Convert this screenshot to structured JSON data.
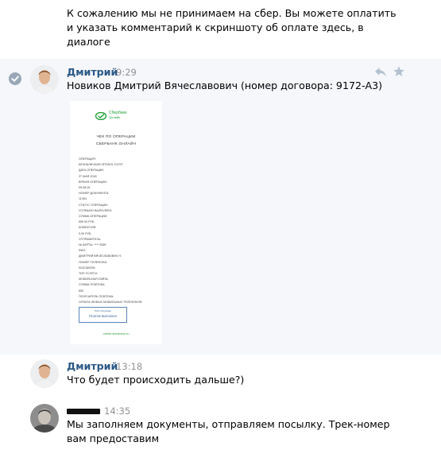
{
  "messages": [
    {
      "text_lines": [
        "К сожалению мы не принимаем на сбер. Вы можете оплатить",
        "и указать комментарий к скриншоту об оплате здесь, в",
        "диалоге"
      ]
    },
    {
      "author": "Дмитрий",
      "time": "9:29",
      "text": "Новиков Дмитрий Вячеславович (номер договора: 9172-А3)",
      "receipt": {
        "logo_line1": "Сбербанк",
        "logo_line2": "Онлайн",
        "title_line1": "ЧЕК ПО ОПЕРАЦИИ",
        "title_line2": "СБЕРБАНК ОНЛАЙН",
        "lines": [
          "ОПЕРАЦИЯ:",
          "БЕЗНАЛИЧНАЯ ОПЛАТА УСЛУГ",
          "ДАТА ОПЕРАЦИИ:",
          "27 МАЯ 2018",
          "ВРЕМЯ ОПЕРАЦИИ:",
          "09:28:15",
          "НОМЕР ДОКУМЕНТА:",
          "11264",
          "СТАТУС ОПЕРАЦИИ:",
          "УСПЕШНО ВЫПОЛНЕН",
          "СУММА ОПЕРАЦИИ:",
          "650.00 РУБ.",
          "КОМИССИЯ:",
          "0.00 РУБ.",
          "ОТПРАВИТЕЛЬ:",
          "№ КАРТЫ: **** 5389",
          "ФИО:",
          "ДМИТРИЙ ВЯЧЕСЛАВОВИЧ Н.",
          "НОМЕР ТЕЛЕФОНА:",
          "9242169206",
          "ТИП УСЛУГИ:",
          "МОБИЛЬНАЯ СВЯЗЬ",
          "СУММА ПЛАТЕЖА:",
          "650",
          "ПОЛУЧАТЕЛЬ ПЛАТЕЖА:",
          "ОПЛАТА ЛЮБЫХ МОБИЛЬНЫХ ТЕЛЕФОНОВ"
        ],
        "stamp_top": "ПАО Сбербанк",
        "stamp_main": "Платеж выполнен",
        "site": "online.sberbank.ru"
      }
    },
    {
      "author": "Дмитрий",
      "time": "13:18",
      "text": "Что будет происходить дальше?)"
    },
    {
      "time": "14:35",
      "text_lines": [
        "Мы заполняем документы, отправляем посылку. Трек-номер",
        "вам предоставим"
      ]
    }
  ],
  "colors": {
    "author_name": "#2a5885",
    "time": "#939393",
    "highlight_bg": "#f5f7fa",
    "action_icons": "#b5c1d0",
    "sber_green": "#21a038"
  },
  "icons": [
    "check-circle-icon",
    "reply-icon",
    "star-icon"
  ]
}
